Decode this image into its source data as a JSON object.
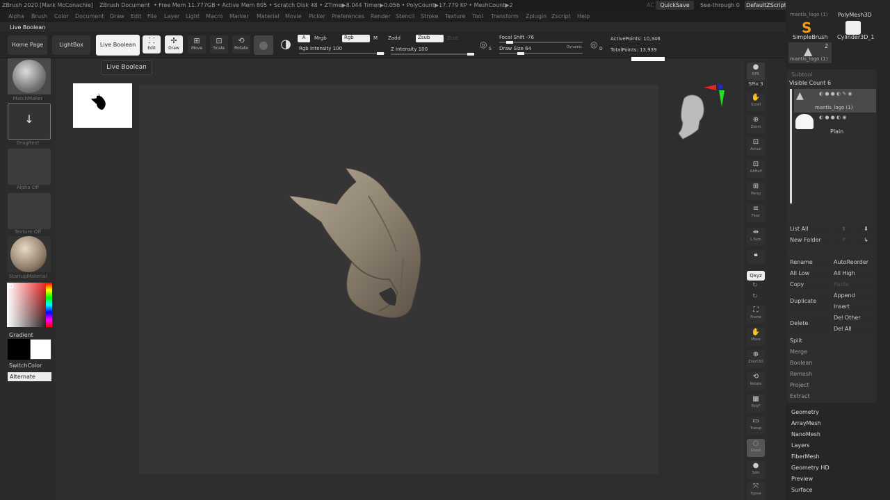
{
  "titlebar": {
    "app": "ZBrush 2020 [Mark McConachie]",
    "document": "ZBrush Document",
    "stats": "• Free Mem 11.777GB • Active Mem 805 • Scratch Disk 48 • ZTime▶8.044 Timer▶0.056 • PolyCount▶17.779 KP • MeshCount▶2",
    "ac": "AC",
    "quicksave": "QuickSave",
    "see_through": "See-through  0",
    "default_script": "DefaultZScript"
  },
  "menu": [
    "Alpha",
    "Brush",
    "Color",
    "Document",
    "Draw",
    "Edit",
    "File",
    "Layer",
    "Light",
    "Macro",
    "Marker",
    "Material",
    "Movie",
    "Picker",
    "Preferences",
    "Render",
    "Stencil",
    "Stroke",
    "Texture",
    "Tool",
    "Transform",
    "Zplugin",
    "Zscript",
    "Help"
  ],
  "palette_label": "Live Boolean",
  "shelf": {
    "home": "Home Page",
    "lightbox": "LightBox",
    "live_boolean": "Live Boolean",
    "edit": "Edit",
    "draw": "Draw",
    "move": "Move",
    "scale": "Scale",
    "rotate": "Rotate",
    "a": "A",
    "mrgb": "Mrgb",
    "rgb": "Rgb",
    "m": "M",
    "zadd": "Zadd",
    "zsub": "Zsub",
    "zcut": "Zcut",
    "rgb_intensity": "Rgb Intensity 100",
    "z_intensity": "Z Intensity 100",
    "focal_shift": "Focal Shift -76",
    "draw_size": "Draw Size 64",
    "dynamic": "Dynamic",
    "active_points": "ActivePoints: 10,346",
    "total_points": "TotalPoints: 13,939",
    "s": "S",
    "d": "D"
  },
  "tooltip": "Live Boolean",
  "left": {
    "matchmaker": "MatchMaker",
    "dragrect": "DragRect",
    "alpha_off": "Alpha Off",
    "texture_off": "Texture Off",
    "startup_material": "StartupMaterial",
    "gradient": "Gradient",
    "switchcolor": "SwitchColor",
    "alternate": "Alternate"
  },
  "right_shelf": [
    {
      "icon": "bpr-icon",
      "label": "BPR"
    },
    {
      "icon": "spix-icon",
      "label": "SPix 3"
    },
    {
      "icon": "scroll-icon",
      "label": "Scroll"
    },
    {
      "icon": "zoom-icon",
      "label": "Zoom"
    },
    {
      "icon": "actual-icon",
      "label": "Actual"
    },
    {
      "icon": "aahalf-icon",
      "label": "AAHalf"
    },
    {
      "icon": "persp-icon",
      "label": "Persp"
    },
    {
      "icon": "floor-icon",
      "label": "Floor"
    },
    {
      "icon": "lsym-icon",
      "label": "L.Sym"
    },
    {
      "icon": "lock-icon",
      "label": ""
    },
    {
      "icon": "xyz-icon",
      "label": "Qxyz"
    },
    {
      "icon": "frame-icon",
      "label": "Frame"
    },
    {
      "icon": "move-icon",
      "label": "Move"
    },
    {
      "icon": "zoom3d-icon",
      "label": "Zoom3D"
    },
    {
      "icon": "rotate-icon",
      "label": "Rotate"
    },
    {
      "icon": "polyf-icon",
      "label": "PolyF"
    },
    {
      "icon": "transp-icon",
      "label": "Transp"
    },
    {
      "icon": "ghost-icon",
      "label": "Ghost"
    },
    {
      "icon": "solo-icon",
      "label": "Solo"
    },
    {
      "icon": "xpose-icon",
      "label": "Xpose"
    }
  ],
  "tool": {
    "top_label": "mantis_logo (1)",
    "polymesh3d": "PolyMesh3D",
    "simplebrush": "SimpleBrush",
    "cylinder": "Cylinder3D_1",
    "count": "2",
    "tool_name": "mantis_logo (1)"
  },
  "subtool": {
    "header": "Subtool",
    "visible_count": "Visible Count 6",
    "items": [
      "mantis_logo (1)",
      "Plain"
    ],
    "list_all": "List All",
    "new_folder": "New Folder",
    "rename": "Rename",
    "autoreorder": "AutoReorder",
    "all_low": "All Low",
    "all_high": "All High",
    "copy": "Copy",
    "paste": "Paste",
    "duplicate": "Duplicate",
    "append": "Append",
    "insert": "Insert",
    "delete": "Delete",
    "del_other": "Del Other",
    "del_all": "Del All",
    "split": "Split",
    "merge": "Merge",
    "boolean": "Boolean",
    "remesh": "Remesh",
    "project": "Project",
    "extract": "Extract"
  },
  "tool_sections": [
    "Geometry",
    "ArrayMesh",
    "NanoMesh",
    "Layers",
    "FiberMesh",
    "Geometry HD",
    "Preview",
    "Surface"
  ],
  "colors": {
    "bg": "#2a2a2a",
    "canvas": "#353535",
    "mesh": "#8f8372",
    "accent_white": "#f3f3f3"
  }
}
